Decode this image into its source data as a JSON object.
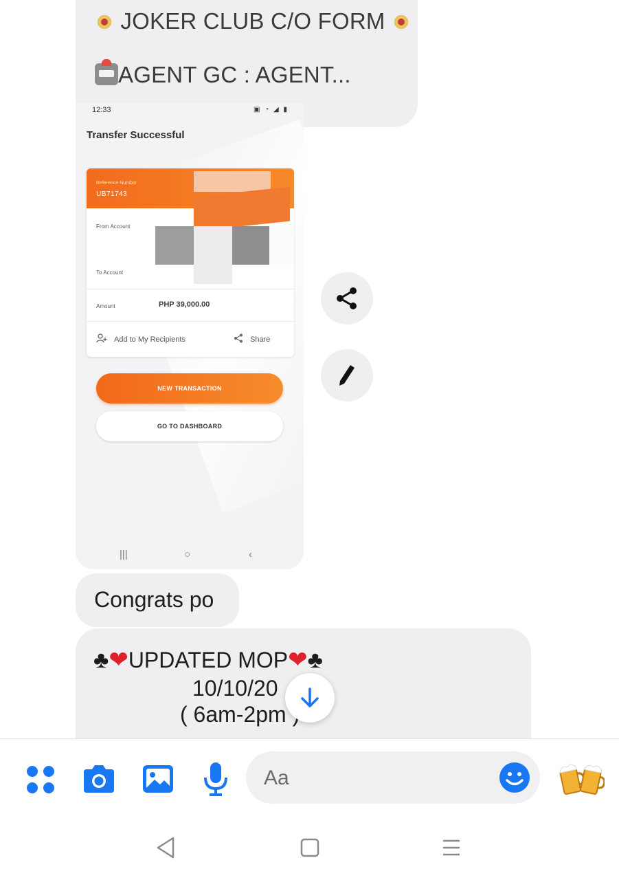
{
  "messages": {
    "top": {
      "line1": "JOKER CLUB C/O FORM",
      "line2": "AGENT GC : AGENT..."
    },
    "screenshot": {
      "time": "12:33",
      "status_icons": "▣ ◔ ◢ ▮",
      "title": "Transfer Successful",
      "reference_label": "Reference Number",
      "reference_value": "UB71743",
      "from_label": "From Account",
      "to_label": "To Account",
      "amount_label": "Amount",
      "amount_value": "PHP 39,000.00",
      "add_recipients": "Add to My Recipients",
      "share": "Share",
      "new_transaction": "NEW TRANSACTION",
      "go_dashboard": "GO TO DASHBOARD"
    },
    "congrats": "Congrats po",
    "mop": {
      "title": "UPDATED MOP",
      "date": "10/10/20",
      "hours": "( 6am-2pm )"
    }
  },
  "composer": {
    "placeholder": "Aa"
  },
  "icons": {
    "more": "four-dots-icon",
    "camera": "camera-icon",
    "gallery": "image-icon",
    "mic": "microphone-icon",
    "emoji": "smiley-icon",
    "quick_reaction": "beer-mugs-icon",
    "share_fab": "share-icon",
    "edit_fab": "pencil-icon",
    "scroll": "arrow-down-icon"
  },
  "colors": {
    "accent": "#1877f2",
    "bubble": "#efeff1",
    "brand_orange": "#f26b1d"
  }
}
